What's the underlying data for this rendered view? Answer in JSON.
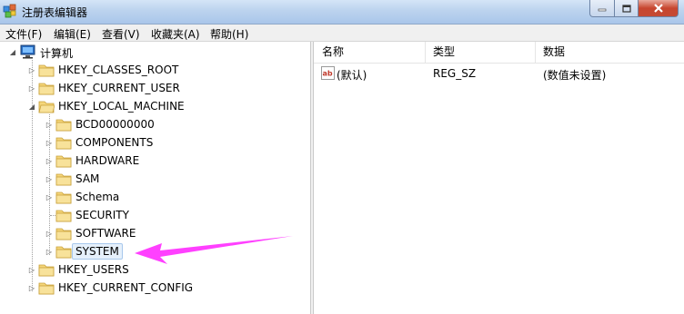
{
  "window": {
    "title": "注册表编辑器"
  },
  "menu": [
    "文件(F)",
    "编辑(E)",
    "查看(V)",
    "收藏夹(A)",
    "帮助(H)"
  ],
  "tree": {
    "root": "计算机",
    "hives": [
      "HKEY_CLASSES_ROOT",
      "HKEY_CURRENT_USER",
      "HKEY_LOCAL_MACHINE",
      "HKEY_USERS",
      "HKEY_CURRENT_CONFIG"
    ],
    "local_machine_children": [
      "BCD00000000",
      "COMPONENTS",
      "HARDWARE",
      "SAM",
      "Schema",
      "SECURITY",
      "SOFTWARE",
      "SYSTEM"
    ],
    "selected": "SYSTEM"
  },
  "list": {
    "columns": [
      "名称",
      "类型",
      "数据"
    ],
    "rows": [
      {
        "name": "(默认)",
        "type": "REG_SZ",
        "data": "(数值未设置)"
      }
    ]
  },
  "annotation": {
    "color": "#ff40ff"
  }
}
